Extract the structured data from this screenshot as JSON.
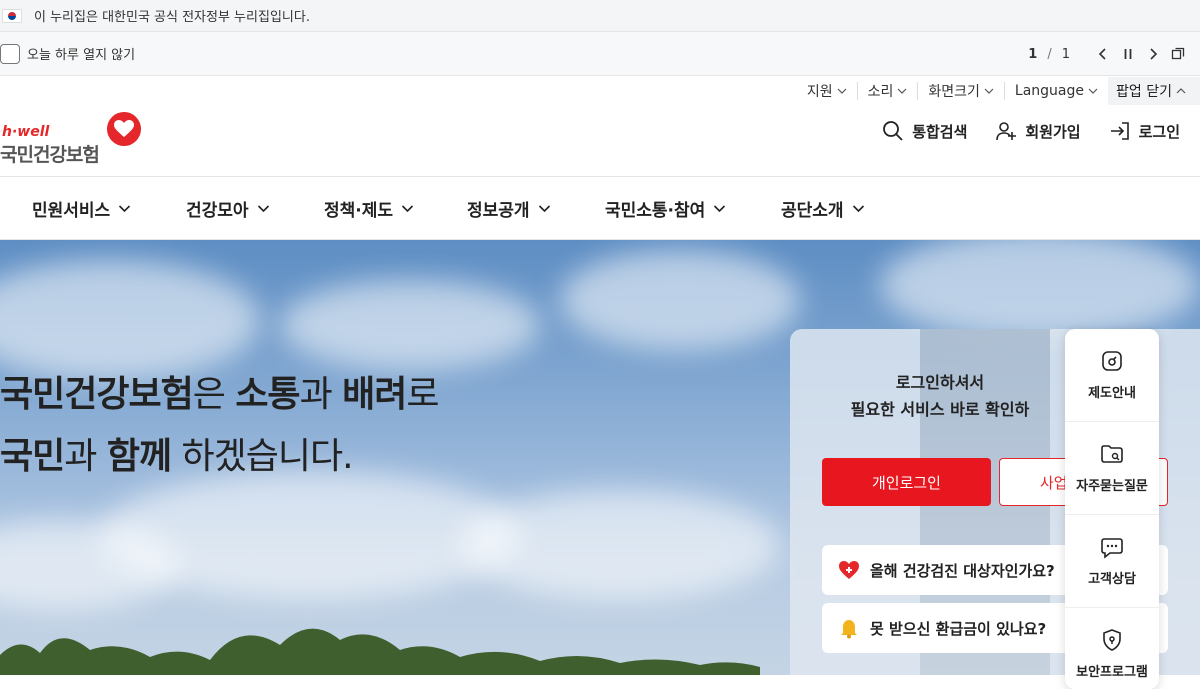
{
  "gov_banner": {
    "text": "이 누리집은 대한민국 공식 전자정부 누리집입니다."
  },
  "popup_bar": {
    "checkbox_label": "오늘 하루 열지 않기",
    "page_current": "1",
    "page_sep": "/",
    "page_total": "1"
  },
  "utility": {
    "support": "지원",
    "sound": "소리",
    "screen_size": "화면크기",
    "language": "Language",
    "popup_close": "팝업 닫기"
  },
  "logo": {
    "tagline": "h·well",
    "name": "국민건강보험"
  },
  "header": {
    "search": "통합검색",
    "signup": "회원가입",
    "login": "로그인"
  },
  "gnb": [
    "민원서비스",
    "건강모아",
    "정책·제도",
    "정보공개",
    "국민소통·참여",
    "공단소개"
  ],
  "hero": {
    "line1_b1": "국민건강보험",
    "line1_t1": "은 ",
    "line1_b2": "소통",
    "line1_t2": "과 ",
    "line1_b3": "배려",
    "line1_t3": "로",
    "line2_b1": "국민",
    "line2_t1": "과 ",
    "line2_b2": "함께",
    "line2_t2": " 하겠습니다."
  },
  "login_panel": {
    "title_line1": "로그인하셔서",
    "title_line2": "필요한 서비스 바로 확인하",
    "personal_login": "개인로그인",
    "business_login": "사업",
    "link1": "올해 건강검진 대상자인가요?",
    "link2": "못 받으신 환급금이 있나요?"
  },
  "quick_menu": [
    "제도안내",
    "자주묻는질문",
    "고객상담",
    "보안프로그램"
  ],
  "colors": {
    "brand_red": "#e5262a",
    "button_red": "#e8161f"
  }
}
